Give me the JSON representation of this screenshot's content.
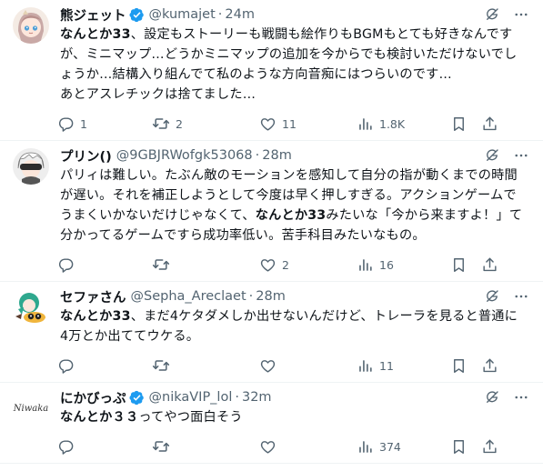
{
  "tweets": [
    {
      "name": "熊ジェット",
      "verified": true,
      "handle": "@kumajet",
      "time": "24m",
      "text_parts": [
        {
          "bold": true,
          "t": "なんとか33"
        },
        {
          "bold": false,
          "t": "、設定もストーリーも戦闘も絵作りもBGMもとても好きなんですが、ミニマップ…どうかミニマップの追加を今からでも検討いただけないでしょうか…結構入り組んでて私のような方向音痴にはつらいのです…"
        },
        {
          "bold": false,
          "br": true,
          "t": "あとアスレチックは捨てました…"
        }
      ],
      "replies": "1",
      "retweets": "2",
      "likes": "11",
      "views": "1.8K"
    },
    {
      "name": "プリン()",
      "verified": false,
      "handle": "@9GBJRWofgk53068",
      "time": "28m",
      "text_parts": [
        {
          "bold": false,
          "t": "パリィは難しい。たぶん敵のモーションを感知して自分の指が動くまでの時間が遅い。それを補正しようとして今度は早く押しすぎる。アクションゲームでうまくいかないだけじゃなくて、"
        },
        {
          "bold": true,
          "t": "なんとか33"
        },
        {
          "bold": false,
          "t": "みたいな「今から来ますよ！」て分かってるゲームですら成功率低い。苦手科目みたいなもの。"
        }
      ],
      "replies": "",
      "retweets": "",
      "likes": "2",
      "views": "16"
    },
    {
      "name": "セファさん",
      "verified": false,
      "handle": "@Sepha_Areclaet",
      "time": "28m",
      "text_parts": [
        {
          "bold": true,
          "t": "なんとか33"
        },
        {
          "bold": false,
          "t": "、まだ4ケタダメしか出せないんだけど、トレーラを見ると普通に4万とか出ててウケる。"
        }
      ],
      "replies": "",
      "retweets": "",
      "likes": "",
      "views": "11"
    },
    {
      "name": "にかびっぷ",
      "verified": true,
      "handle": "@nikaVIP_lol",
      "time": "32m",
      "text_parts": [
        {
          "bold": true,
          "t": "なんとか３３"
        },
        {
          "bold": false,
          "t": "ってやつ面白そう"
        }
      ],
      "replies": "",
      "retweets": "",
      "likes": "",
      "views": "374",
      "avatar_text": "Niwaka"
    }
  ],
  "colors": {
    "text": "#0f1419",
    "secondary": "#536471",
    "verified": "#1d9bf0",
    "divider": "#eff3f4"
  },
  "icons": {
    "reply": "reply-icon",
    "retweet": "retweet-icon",
    "like": "heart-icon",
    "views": "views-icon",
    "bookmark": "bookmark-icon",
    "share": "share-icon",
    "grok": "grok-icon",
    "more": "more-icon"
  }
}
